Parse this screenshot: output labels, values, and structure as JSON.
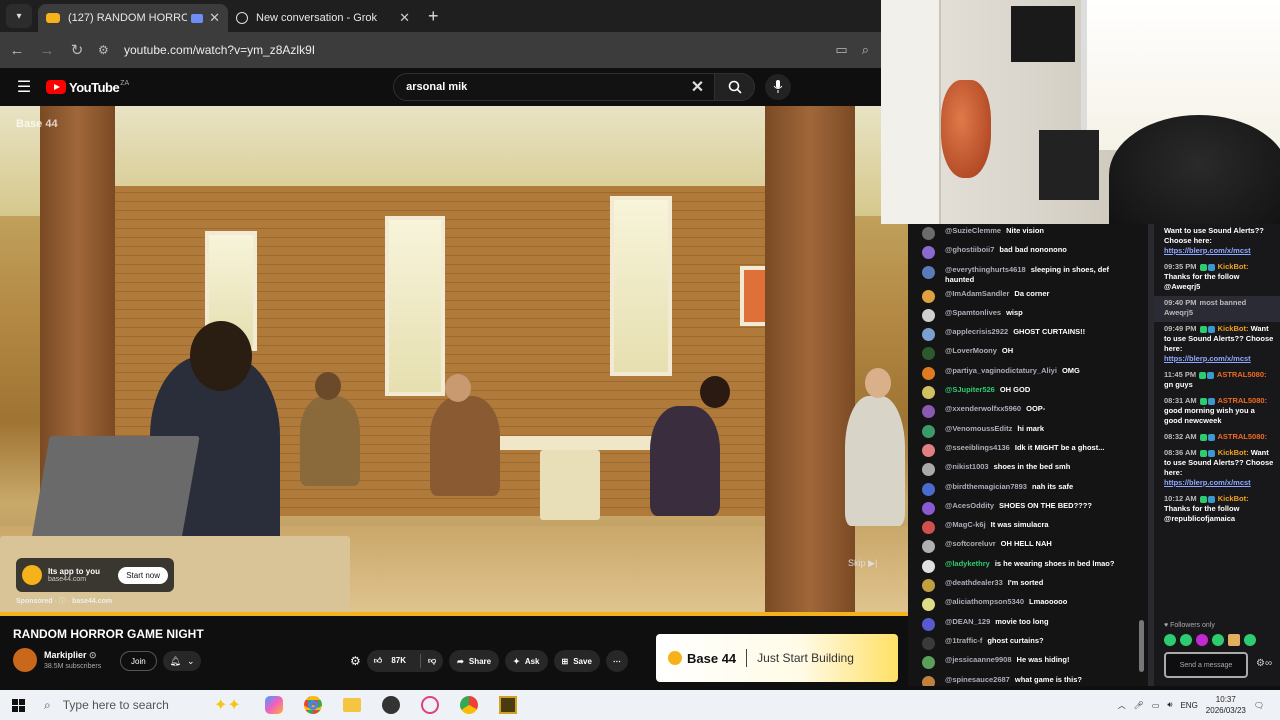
{
  "browser": {
    "tabs": [
      {
        "title": "(127) RANDOM HORROR G",
        "active": true,
        "favicon_color": "#f5b21b"
      },
      {
        "title": "New conversation - Grok",
        "active": false,
        "favicon_color": "#222222"
      }
    ],
    "url": "youtube.com/watch?v=ym_z8Azlk9I"
  },
  "youtube": {
    "logo_text": "YouTube",
    "country": "ZA",
    "search_value": "arsonal mik",
    "video": {
      "watermark": "Base 44",
      "ad_card_title": "Its app to you",
      "ad_card_domain": "base44.com",
      "ad_card_cta": "Start now",
      "sponsored_label": "Sponsored",
      "sponsored_domain": "base44.com",
      "skip_label": "Skip",
      "title": "RANDOM HORROR GAME NIGHT"
    },
    "channel": {
      "name": "Markiplier",
      "subscribers": "38.5M subscribers",
      "join_label": "Join"
    },
    "actions": {
      "likes": "87K",
      "share": "Share",
      "ask": "Ask",
      "save": "Save"
    },
    "banner": {
      "brand": "Base 44",
      "tagline": "Just Start Building"
    }
  },
  "chat1": [
    {
      "user": "@SuzieClemme",
      "text": "Nite vision",
      "color": "#6b6b6b"
    },
    {
      "user": "@ghostiiboii7",
      "text": "bad bad nononono",
      "color": "#8a6ad0"
    },
    {
      "user": "@everythinghurts4618",
      "text": "sleeping in shoes, def haunted",
      "color": "#5b7bb8"
    },
    {
      "user": "@ImAdamSandler",
      "text": "Da corner",
      "color": "#e0a040"
    },
    {
      "user": "@Spamtonlives",
      "text": "wisp",
      "color": "#d0d0d0"
    },
    {
      "user": "@applecrisis2922",
      "text": "GHOST CURTAINS!!",
      "color": "#7aa0d0"
    },
    {
      "user": "@LoverMoony",
      "text": "OH",
      "color": "#2d5a2d"
    },
    {
      "user": "@partiya_vaginodictatury_Aliyi",
      "text": "OMG",
      "color": "#e07a20"
    },
    {
      "user": "@SJupiter526",
      "text": "OH GOD",
      "color": "#d0c060",
      "userColor": "#2ecc71"
    },
    {
      "user": "@xxenderwolfxx5960",
      "text": "OOP-",
      "color": "#8a5ab0"
    },
    {
      "user": "@VenomoussEditz",
      "text": "hi mark",
      "color": "#3a9a6a"
    },
    {
      "user": "@sseeiblings4136",
      "text": "Idk it MIGHT be a ghost...",
      "color": "#e08080"
    },
    {
      "user": "@nikist1003",
      "text": "shoes in the bed smh",
      "color": "#aaaaaa"
    },
    {
      "user": "@birdthemagician7893",
      "text": "nah its safe",
      "color": "#4a6ad0"
    },
    {
      "user": "@AcesOddity",
      "text": "SHOES ON THE BED????",
      "color": "#8a5ad0"
    },
    {
      "user": "@MagC-k6j",
      "text": "It was simulacra",
      "color": "#d05050"
    },
    {
      "user": "@softcoreluvr",
      "text": "OH HELL NAH",
      "color": "#b0b0b0"
    },
    {
      "user": "@ladykethry",
      "text": "is he wearing shoes in bed lmao?",
      "color": "#e0e0e0",
      "userColor": "#2ecc71"
    },
    {
      "user": "@deathdealer33",
      "text": "I'm sorted",
      "color": "#c0a040"
    },
    {
      "user": "@aliciathompson5340",
      "text": "Lmaooooo",
      "color": "#dddd88"
    },
    {
      "user": "@DEAN_129",
      "text": "movie too long",
      "color": "#5a5ad0"
    },
    {
      "user": "@1traffic-f",
      "text": "ghost curtains?",
      "color": "#3a3a3a"
    },
    {
      "user": "@jessicaanne9908",
      "text": "He was hiding!",
      "color": "#5aa05a"
    },
    {
      "user": "@spinesauce2687",
      "text": "what game is this?",
      "color": "#c08040"
    }
  ],
  "chat2": {
    "messages": [
      {
        "time": "",
        "user": "",
        "text": "Want to use Sound Alerts?? Choose here:",
        "link": "https://blerp.com/x/mcst"
      },
      {
        "time": "09:35 PM",
        "user": "KickBot:",
        "text": "Thanks for the follow @Aweqrj5",
        "link": ""
      },
      {
        "time": "09:40 PM",
        "user": "",
        "text": "most banned Aweqrj5",
        "link": ""
      },
      {
        "time": "09:49 PM",
        "user": "KickBot:",
        "text": "Want to use Sound Alerts?? Choose here:",
        "link": "https://blerp.com/x/mcst"
      },
      {
        "time": "11:45 PM",
        "user": "ASTRAL5080:",
        "text": "gn guys",
        "link": ""
      },
      {
        "time": "08:31 AM",
        "user": "ASTRAL5080:",
        "text": "good morning wish you a good newcweek",
        "link": ""
      },
      {
        "time": "08:32 AM",
        "user": "ASTRAL5080:",
        "text": "",
        "link": ""
      },
      {
        "time": "08:36 AM",
        "user": "KickBot:",
        "text": "Want to use Sound Alerts?? Choose here:",
        "link": "https://blerp.com/x/mcst"
      },
      {
        "time": "10:12 AM",
        "user": "KickBot:",
        "text": "Thanks for the follow @republicofjamaica",
        "link": ""
      }
    ],
    "followers_only": "Followers only",
    "send_placeholder": "Send a message"
  },
  "taskbar": {
    "search_placeholder": "Type here to search",
    "lang": "ENG",
    "time": "10:37",
    "date": "2026/03/23"
  },
  "colors": {
    "accent": "#f5b21b",
    "yt_red": "#ff0000",
    "kick_green": "#2ecc71"
  }
}
